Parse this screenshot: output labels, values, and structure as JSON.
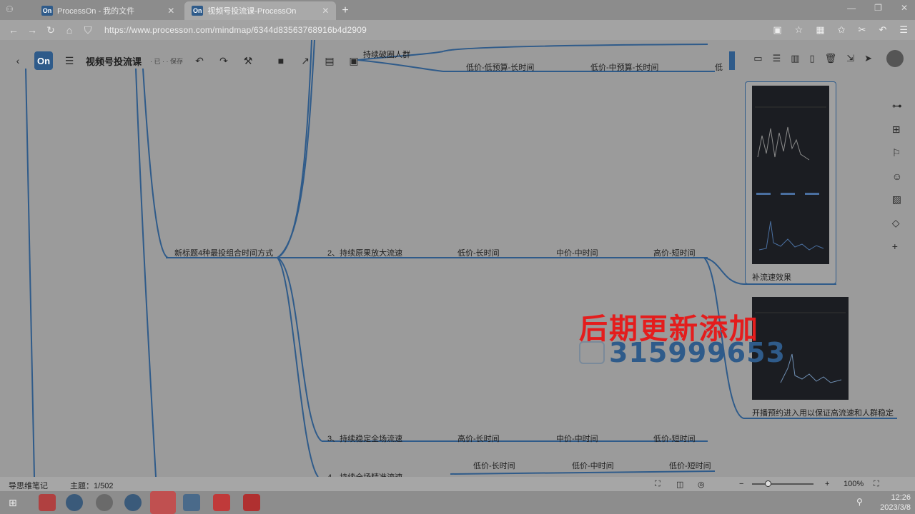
{
  "browser": {
    "tabs": [
      {
        "logo": "On",
        "label": "ProcessOn - 我的文件"
      },
      {
        "logo": "On",
        "label": "视频号投流课-ProcessOn"
      }
    ],
    "url": "https://www.processon.com/mindmap/6344d83563768916b4d2909"
  },
  "app": {
    "logo": "On",
    "title": "视频号投流课",
    "subtitle": "· 已 · · 保存"
  },
  "mindmap": {
    "nodes": {
      "top1": "持续破圈人群",
      "top2": "低价-低预算-长时间",
      "top3": "低价-中预算-长时间",
      "top4": "低",
      "center": "新标题4种最投组合时间方式",
      "branch2": "2、持续原果放大流速",
      "b2a": "低价-长时间",
      "b2b": "中价-中时间",
      "b2c": "高价-短时间",
      "branch3": "3、持续稳定全场流速",
      "b3a": "高价-长时间",
      "b3b": "中价-中时间",
      "b3c": "低价-短时间",
      "branch4": "4、持续全场精准流速",
      "b4a": "低价-长时间",
      "b4b": "低价-中时间",
      "b4c": "低价-短时间"
    },
    "card1_caption": "补流速效果",
    "card2_caption": "开播预约进入用以保证高流速和人群稳定"
  },
  "overlay": {
    "headline": "后期更新添加",
    "number": "315999653"
  },
  "status": {
    "left": "导思维笔记",
    "topics": "主题：1/502",
    "zoom": "100%"
  },
  "clock": {
    "time": "12:26",
    "date": "2023/3/8"
  },
  "colors": {
    "accent": "#2f5b8a",
    "overlay_red": "#e41d1d"
  }
}
